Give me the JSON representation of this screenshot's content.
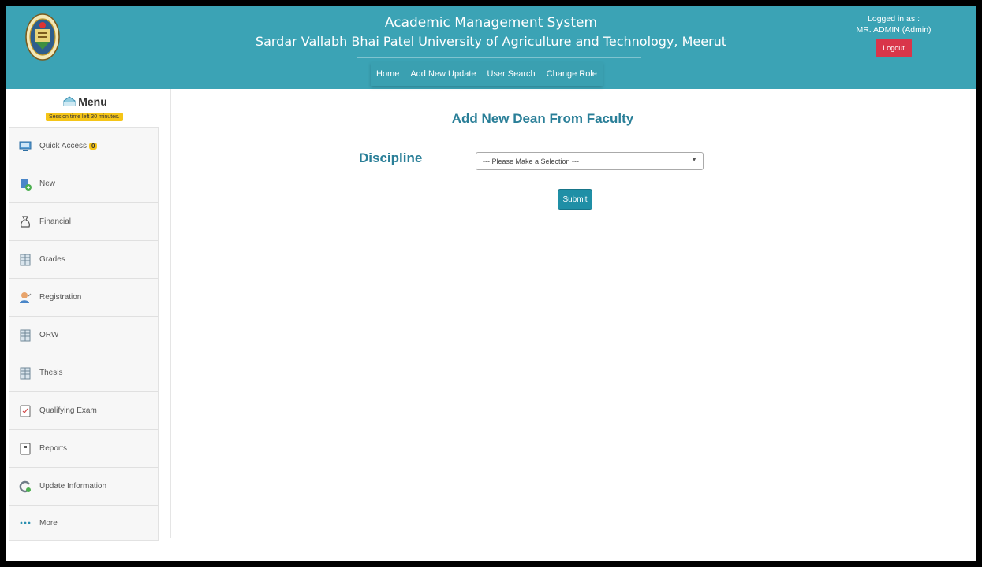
{
  "header": {
    "title_line1": "Academic Management System",
    "title_line2": "Sardar Vallabh Bhai Patel University of Agriculture and Technology, Meerut",
    "logo_icon": "university-seal-icon",
    "nav": [
      {
        "label": "Home"
      },
      {
        "label": "Add New Update"
      },
      {
        "label": "User Search"
      },
      {
        "label": "Change Role"
      }
    ],
    "logged_in_label": "Logged in as :",
    "user": "MR. ADMIN (Admin)",
    "logout_label": "Logout"
  },
  "sidebar": {
    "menu_title": "Menu",
    "session_text": "Session time left 30 minutes.",
    "items": [
      {
        "label": "Quick Access",
        "icon": "monitor-icon",
        "badge": "0"
      },
      {
        "label": "New",
        "icon": "new-document-icon"
      },
      {
        "label": "Financial",
        "icon": "money-bag-icon"
      },
      {
        "label": "Grades",
        "icon": "grid-icon"
      },
      {
        "label": "Registration",
        "icon": "user-icon"
      },
      {
        "label": "ORW",
        "icon": "grid-icon"
      },
      {
        "label": "Thesis",
        "icon": "grid-icon"
      },
      {
        "label": "Qualifying Exam",
        "icon": "exam-document-icon"
      },
      {
        "label": "Reports",
        "icon": "report-icon"
      },
      {
        "label": "Update Information",
        "icon": "update-icon"
      },
      {
        "label": "More",
        "icon": "ellipsis-icon"
      }
    ]
  },
  "main": {
    "title": "Add New Dean From Faculty",
    "discipline_label": "Discipline",
    "discipline_select_value": "--- Please Make a Selection ---",
    "submit_label": "Submit"
  },
  "colors": {
    "header_bg": "#3ba3b5",
    "heading": "#2a7f98",
    "logout": "#d9354a",
    "badge": "#f5c518",
    "submit": "#1f8fa6"
  }
}
